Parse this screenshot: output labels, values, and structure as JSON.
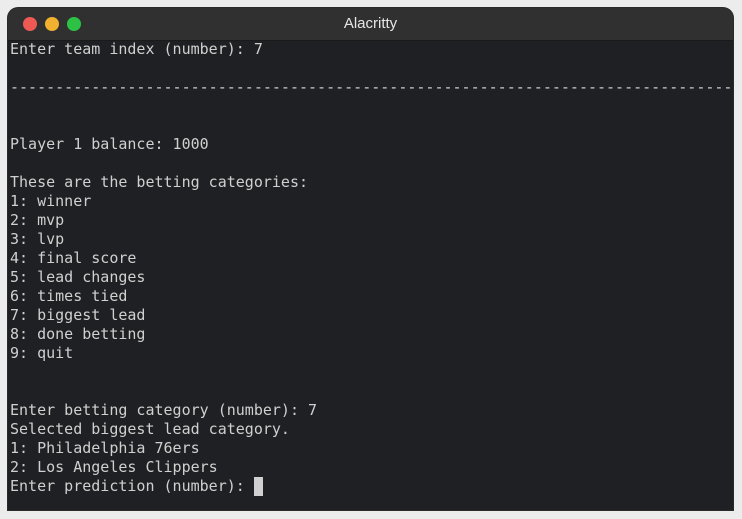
{
  "window": {
    "title": "Alacritty"
  },
  "terminal": {
    "lines": [
      "Enter team index (number): 7",
      "",
      "--------------------------------------------------------------------------------",
      "",
      "",
      "Player 1 balance: 1000",
      "",
      "These are the betting categories:",
      "1: winner",
      "2: mvp",
      "3: lvp",
      "4: final score",
      "5: lead changes",
      "6: times tied",
      "7: biggest lead",
      "8: done betting",
      "9: quit",
      "",
      "",
      "Enter betting category (number): 7",
      "Selected biggest lead category.",
      "1: Philadelphia 76ers",
      "2: Los Angeles Clippers",
      "Enter prediction (number): "
    ]
  },
  "colors": {
    "background": "#1f2023",
    "foreground": "#d0d0d0",
    "titlebar": "#303030",
    "close": "#ee5a53",
    "minimize": "#f1b02f",
    "maximize": "#2dc245"
  }
}
